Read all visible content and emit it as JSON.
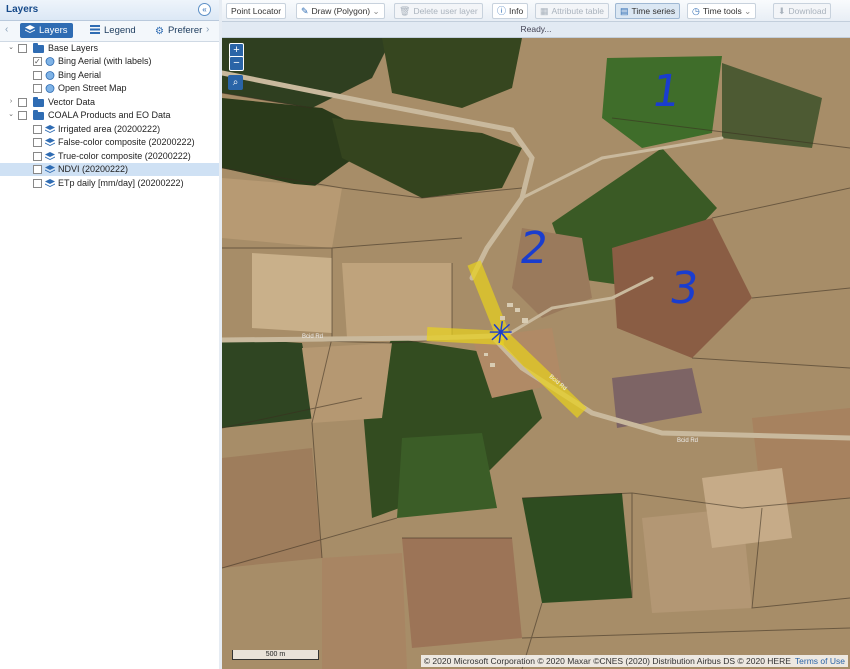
{
  "panel": {
    "title": "Layers",
    "tabs": [
      {
        "label": "Layers",
        "icon": "layers-icon",
        "active": true
      },
      {
        "label": "Legend",
        "icon": "list-icon",
        "active": false
      },
      {
        "label": "Preferer",
        "icon": "gear-icon",
        "active": false
      }
    ],
    "tree": {
      "base_layers": {
        "label": "Base Layers",
        "items": [
          {
            "label": "Bing Aerial (with labels)",
            "checked": true
          },
          {
            "label": "Bing Aerial",
            "checked": false
          },
          {
            "label": "Open Street Map",
            "checked": false
          }
        ]
      },
      "vector_data": {
        "label": "Vector Data"
      },
      "coala": {
        "label": "COALA Products and EO Data",
        "items": [
          {
            "label": "Irrigated area (20200222)",
            "checked": false
          },
          {
            "label": "False-color composite (20200222)",
            "checked": false
          },
          {
            "label": "True-color composite (20200222)",
            "checked": false
          },
          {
            "label": "NDVI (20200222)",
            "checked": false,
            "selected": true
          },
          {
            "label": "ETp daily [mm/day] (20200222)",
            "checked": false
          }
        ]
      }
    }
  },
  "toolbar": {
    "point_locator": "Point Locator",
    "draw": "Draw (Polygon)",
    "delete_layer": "Delete user layer",
    "info": "Info",
    "attribute_table": "Attribute table",
    "time_series": "Time series",
    "time_tools": "Time tools",
    "download": "Download"
  },
  "status": "Ready...",
  "map": {
    "zoom_in": "+",
    "zoom_out": "−",
    "scale_label": "500 m",
    "attribution": "© 2020 Microsoft Corporation © 2020 Maxar ©CNES (2020) Distribution Airbus DS © 2020 HERE",
    "terms": "Terms of Use",
    "road_labels": [
      "Bcid Rd",
      "Bcid Rd",
      "Bcid Rd"
    ],
    "annotations": [
      "1",
      "2",
      "3",
      "✳"
    ]
  },
  "colors": {
    "accent": "#2f6cb3",
    "annotation": "#1a3dcf",
    "highlight": "#e8d11c"
  }
}
